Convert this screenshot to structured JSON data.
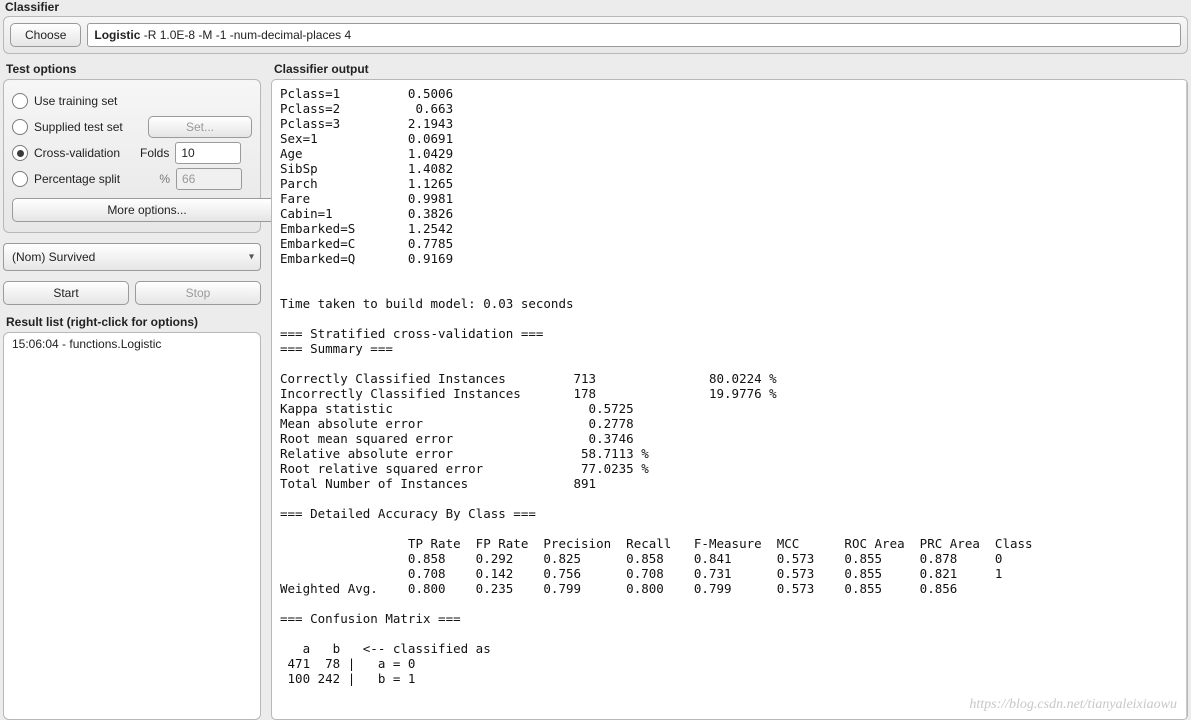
{
  "classifier": {
    "group_title": "Classifier",
    "choose_label": "Choose",
    "name": "Logistic",
    "options": "-R 1.0E-8 -M -1 -num-decimal-places 4"
  },
  "test_options": {
    "title": "Test options",
    "options": [
      {
        "label": "Use training set",
        "selected": false
      },
      {
        "label": "Supplied test set",
        "selected": false,
        "button": "Set..."
      },
      {
        "label": "Cross-validation",
        "selected": true,
        "sub_label": "Folds",
        "value": "10"
      },
      {
        "label": "Percentage split",
        "selected": false,
        "sub_label": "%",
        "value": "66"
      }
    ],
    "more_label": "More options..."
  },
  "class_combo": {
    "value": "(Nom) Survived"
  },
  "buttons": {
    "start": "Start",
    "stop": "Stop"
  },
  "result_list": {
    "title": "Result list (right-click for options)",
    "items": [
      "15:06:04 - functions.Logistic"
    ]
  },
  "output": {
    "title": "Classifier output",
    "text": "Pclass=1         0.5006\nPclass=2          0.663\nPclass=3         2.1943\nSex=1            0.0691\nAge              1.0429\nSibSp            1.4082\nParch            1.1265\nFare             0.9981\nCabin=1          0.3826\nEmbarked=S       1.2542\nEmbarked=C       0.7785\nEmbarked=Q       0.9169\n\n\nTime taken to build model: 0.03 seconds\n\n=== Stratified cross-validation ===\n=== Summary ===\n\nCorrectly Classified Instances         713               80.0224 %\nIncorrectly Classified Instances       178               19.9776 %\nKappa statistic                          0.5725\nMean absolute error                      0.2778\nRoot mean squared error                  0.3746\nRelative absolute error                 58.7113 %\nRoot relative squared error             77.0235 %\nTotal Number of Instances              891     \n\n=== Detailed Accuracy By Class ===\n\n                 TP Rate  FP Rate  Precision  Recall   F-Measure  MCC      ROC Area  PRC Area  Class\n                 0.858    0.292    0.825      0.858    0.841      0.573    0.855     0.878     0\n                 0.708    0.142    0.756      0.708    0.731      0.573    0.855     0.821     1\nWeighted Avg.    0.800    0.235    0.799      0.800    0.799      0.573    0.855     0.856     \n\n=== Confusion Matrix ===\n\n   a   b   <-- classified as\n 471  78 |   a = 0\n 100 242 |   b = 1\n"
  },
  "watermark": "https://blog.csdn.net/tianyaleixiaowu"
}
